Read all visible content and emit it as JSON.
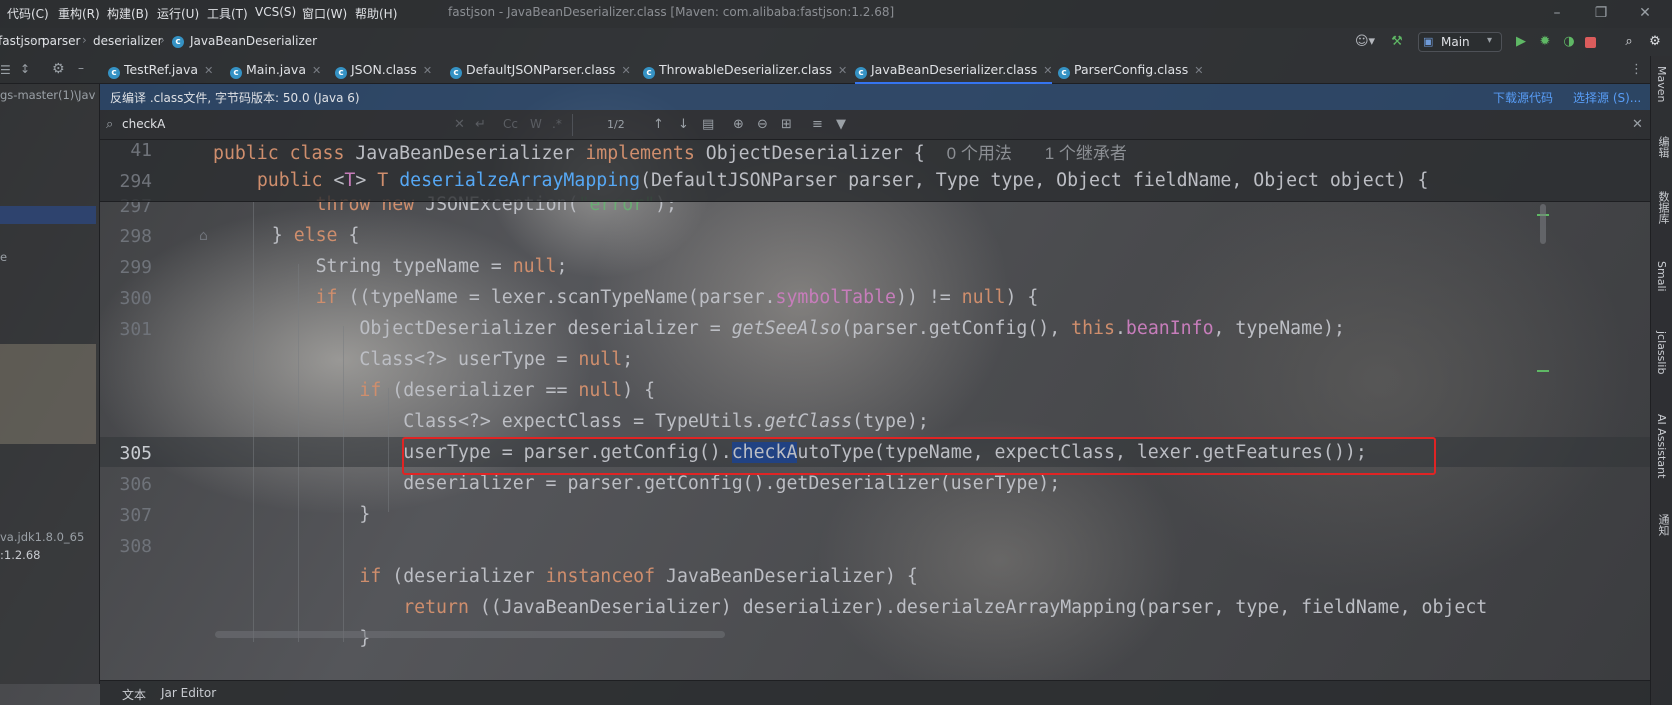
{
  "menu": [
    "代码(C)",
    "重构(R)",
    "构建(B)",
    "运行(U)",
    "工具(T)",
    "VCS(S)",
    "窗口(W)",
    "帮助(H)"
  ],
  "app_title": "fastjson - JavaBeanDeserializer.class [Maven: com.alibaba:fastjson:1.2.68]",
  "breadcrumb": [
    "fastjson",
    "parser",
    "deserializer",
    "JavaBeanDeserializer"
  ],
  "run_config": "Main",
  "tabs": [
    "TestRef.java",
    "Main.java",
    "JSON.class",
    "DefaultJSONParser.class",
    "ThrowableDeserializer.class",
    "JavaBeanDeserializer.class",
    "ParserConfig.class"
  ],
  "banner": {
    "text": "反编译 .class文件, 字节码版本: 50.0 (Java 6)",
    "download_link": "下载源代码",
    "choose_link": "选择源 (S)..."
  },
  "search": {
    "query": "checkA",
    "match_count": "1/2",
    "cc": "Cc",
    "w": "W",
    "regex": ".*"
  },
  "left_panel": {
    "item1": "gs-master(1)\\Jav",
    "item2": "e",
    "item3": "va.jdk1.8.0_65",
    "item4": ":1.2.68"
  },
  "right_strip": [
    "Maven",
    "编辑",
    "数据库",
    "Smali",
    "jclasslib",
    "AI Assistant",
    "通知"
  ],
  "sticky_lines": [
    {
      "num": "41",
      "hint1": "0 个用法",
      "hint2": "1 个继承者"
    },
    {
      "num": "294"
    }
  ],
  "line_numbers": [
    "297",
    "298",
    "299",
    "300",
    "301",
    "",
    "",
    "",
    "305",
    "306",
    "307",
    "308",
    "",
    "",
    ""
  ],
  "bottom_tabs": [
    "文本",
    "Jar Editor"
  ]
}
